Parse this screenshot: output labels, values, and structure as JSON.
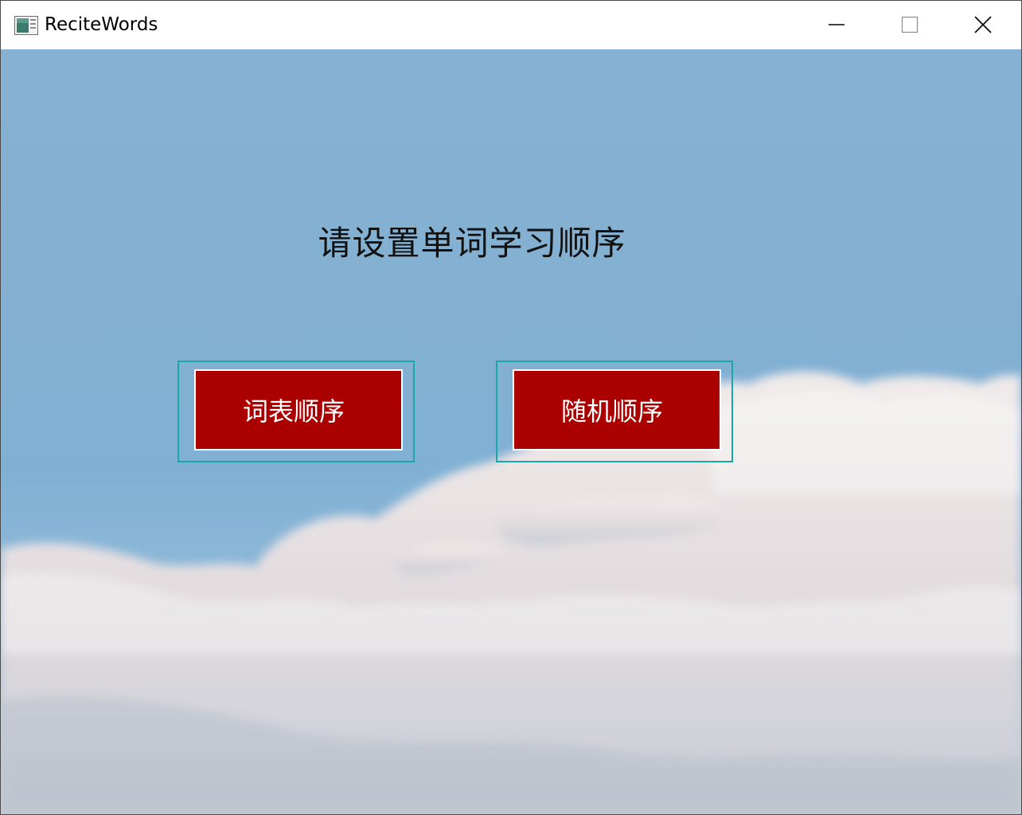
{
  "window": {
    "title": "ReciteWords",
    "controls": {
      "minimize": "minimize-icon",
      "maximize": "maximize-icon",
      "close": "close-icon"
    }
  },
  "main": {
    "heading": "请设置单词学习顺序",
    "buttons": [
      {
        "label": "词表顺序"
      },
      {
        "label": "随机顺序"
      }
    ]
  },
  "colors": {
    "button_bg": "#ab0000",
    "button_border": "#ffffff",
    "frame_border": "#1aa7a7",
    "sky": "#86b1d3"
  }
}
